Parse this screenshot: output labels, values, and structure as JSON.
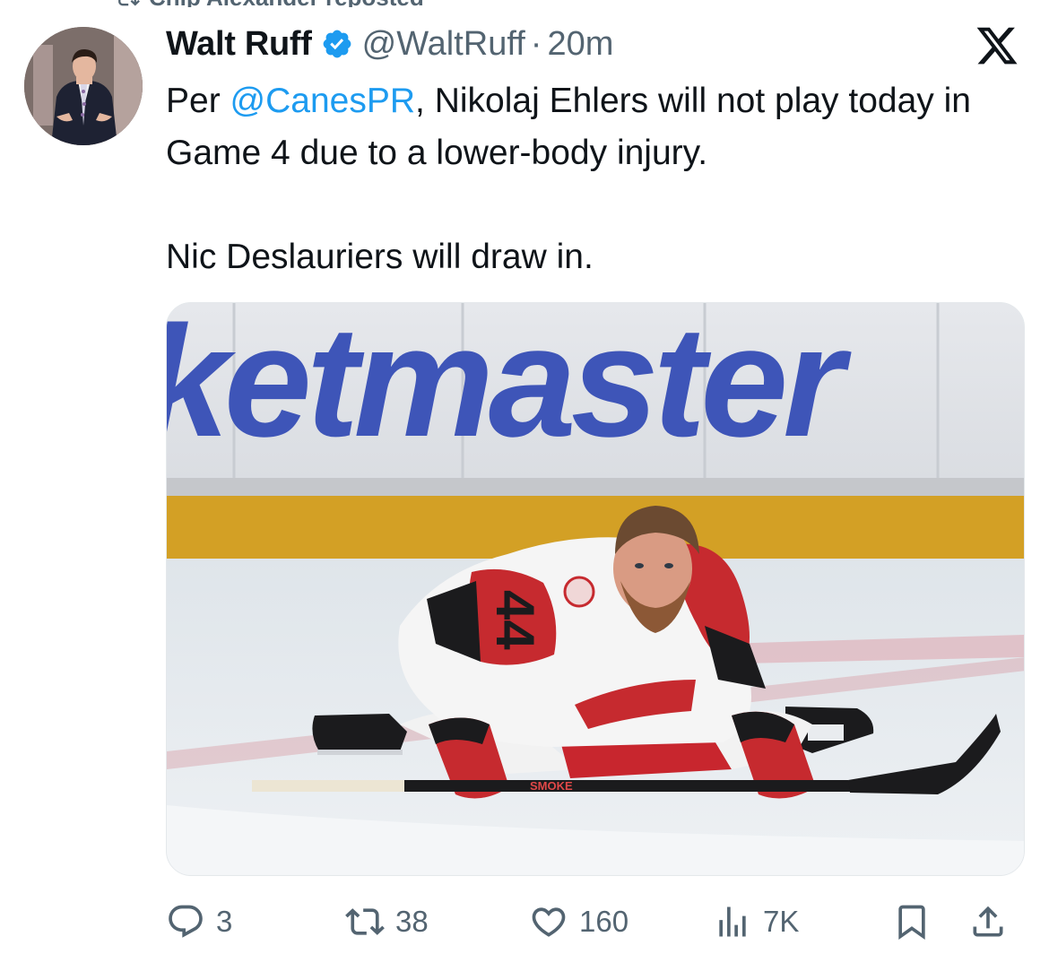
{
  "repost_banner": {
    "text": "Chip Alexander reposted",
    "icon": "retweet-icon"
  },
  "tweet": {
    "author": {
      "display_name": "Walt Ruff",
      "handle": "@WaltRuff",
      "verified": true,
      "avatar_icon": "profile-photo"
    },
    "separator": "·",
    "timestamp": "20m",
    "platform_icon": "x-logo-icon",
    "text": {
      "line1_prefix": "Per ",
      "mention": "@CanesPR",
      "line1_suffix": ", Nikolaj Ehlers will not play today in Game 4 due to a lower-body injury.",
      "line2": "Nic Deslauriers will draw in."
    },
    "media": {
      "board_text": "ketmaster",
      "jersey_number": "44",
      "stick_text": "SMOKE"
    },
    "actions": {
      "replies": "3",
      "reposts": "38",
      "likes": "160",
      "views": "7K"
    }
  },
  "colors": {
    "accent": "#1d9bf0",
    "muted": "#536471",
    "text": "#0f1419"
  }
}
